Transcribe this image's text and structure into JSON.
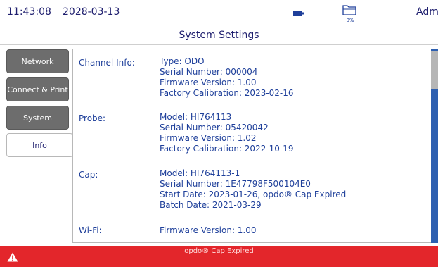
{
  "status": {
    "time": "11:43:08",
    "date": "2028-03-13",
    "battery_icon": "battery-icon",
    "storage_icon": "folder-icon",
    "storage_percent": "0%",
    "user": "Admir"
  },
  "page": {
    "title": "System Settings"
  },
  "nav": {
    "items": [
      {
        "label": "Network",
        "active": false
      },
      {
        "label": "Connect & Print",
        "active": false
      },
      {
        "label": "System",
        "active": false
      },
      {
        "label": "Info",
        "active": true
      }
    ]
  },
  "info": {
    "channel": {
      "label": "Channel Info:",
      "lines": [
        "Type: ODO",
        "Serial Number: 000004",
        "Firmware Version: 1.00",
        "Factory Calibration: 2023-02-16"
      ]
    },
    "probe": {
      "label": "Probe:",
      "lines": [
        "Model: HI764113",
        "Serial Number: 05420042",
        "Firmware Version: 1.02",
        "Factory Calibration: 2022-10-19"
      ]
    },
    "cap": {
      "label": "Cap:",
      "lines": [
        "Model: HI764113-1",
        "Serial Number: 1E47798F500104E0",
        "Start Date: 2023-01-26, opdo® Cap Expired",
        "Batch Date: 2021-03-29"
      ]
    },
    "wifi": {
      "label": "Wi-Fi:",
      "lines": [
        "Firmware Version: 1.00"
      ]
    }
  },
  "alarm": {
    "message": "opdo® Cap Expired",
    "icon": "warning-icon"
  },
  "colors": {
    "text_primary": "#1e3f9a",
    "nav_inactive": "#6d6d6d",
    "alarm": "#e3262b",
    "scroll_track": "#2d5fb0"
  }
}
